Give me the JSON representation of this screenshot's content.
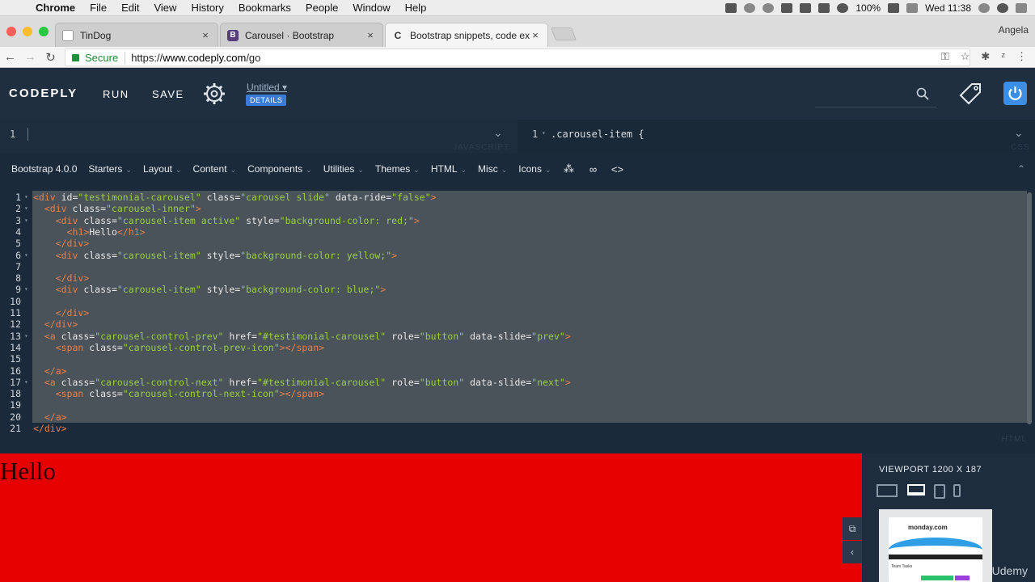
{
  "menubar": {
    "app": "Chrome",
    "items": [
      "File",
      "Edit",
      "View",
      "History",
      "Bookmarks",
      "People",
      "Window",
      "Help"
    ],
    "battery": "100%",
    "clock": "Wed 11:38"
  },
  "tabs": [
    {
      "title": "TinDog",
      "favicon": "page-icon"
    },
    {
      "title": "Carousel · Bootstrap",
      "favicon": "bootstrap-icon",
      "favicon_text": "B"
    },
    {
      "title": "Bootstrap snippets, code exam",
      "favicon": "codeply-icon",
      "favicon_text": "C"
    }
  ],
  "profile": "Angela",
  "address": {
    "secure_label": "Secure",
    "url_scheme": "https://",
    "url_host": "www.codeply.com",
    "url_path": "/go"
  },
  "codeply": {
    "logo": "CODEPLY",
    "run": "RUN",
    "save": "SAVE",
    "untitled": "Untitled",
    "details": "DETAILS"
  },
  "js_pane": {
    "line": "1",
    "label": "JAVASCRIPT"
  },
  "css_pane": {
    "line": "1",
    "code": ".carousel-item {",
    "label": "CSS"
  },
  "toolbar": {
    "version": "Bootstrap 4.0.0",
    "menus": [
      "Starters",
      "Layout",
      "Content",
      "Components",
      "Utilities",
      "Themes",
      "HTML",
      "Misc",
      "Icons"
    ]
  },
  "html_label": "HTML",
  "preview": {
    "heading": "Hello"
  },
  "viewport": {
    "title": "VIEWPORT 1200 X 187"
  },
  "ad": {
    "brand": "monday.com",
    "sub": "Team Tasks"
  },
  "watermark": "Udemy",
  "colors": {
    "accent": "#3a7bd5",
    "preview_bg": "#e60000",
    "tag": "#e8804a",
    "string": "#9acd45"
  }
}
